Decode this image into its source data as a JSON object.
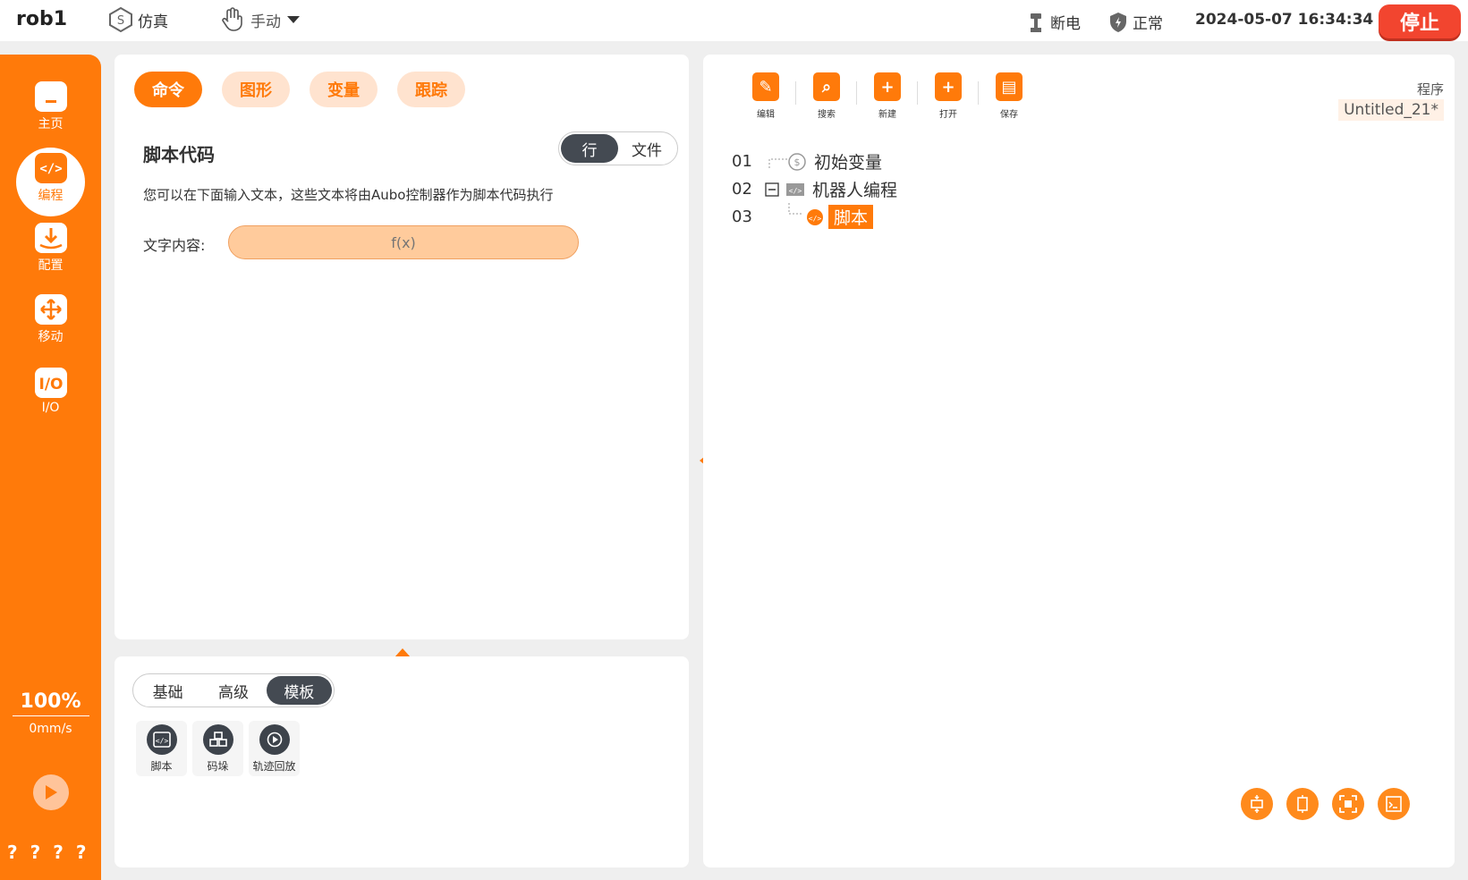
{
  "topbar": {
    "robot_name": "rob1",
    "mode_sim": "仿真",
    "mode_manual": "手动",
    "power_status": "断电",
    "safety_status": "正常",
    "datetime": "2024-05-07 16:34:34",
    "stop_label": "停止"
  },
  "sidebar": {
    "items": [
      {
        "label": "主页",
        "icon": "home-icon"
      },
      {
        "label": "编程",
        "icon": "code-icon"
      },
      {
        "label": "配置",
        "icon": "config-icon"
      },
      {
        "label": "移动",
        "icon": "move-icon"
      },
      {
        "label": "I/O",
        "icon": "io-icon"
      }
    ],
    "speed_percent": "100%",
    "speed_value": "0mm/s",
    "help": [
      "?",
      "?",
      "?",
      "?"
    ]
  },
  "command_panel": {
    "tabs": [
      "命令",
      "图形",
      "变量",
      "跟踪"
    ],
    "active_tab": "命令",
    "title": "脚本代码",
    "mode_options": [
      "行",
      "文件"
    ],
    "active_mode": "行",
    "description": "您可以在下面输入文本，这些文本将由Aubo控制器作为脚本代码执行",
    "field_label": "文字内容:",
    "field_placeholder": "f(x)"
  },
  "library_panel": {
    "categories": [
      "基础",
      "高级",
      "模板"
    ],
    "active_category": "模板",
    "items": [
      {
        "label": "脚本",
        "icon": "script-icon"
      },
      {
        "label": "码垛",
        "icon": "palletizing-icon"
      },
      {
        "label": "轨迹回放",
        "icon": "replay-icon"
      }
    ]
  },
  "program_panel": {
    "toolbar": [
      {
        "label": "编辑",
        "icon": "edit-icon"
      },
      {
        "label": "搜索",
        "icon": "search-icon"
      },
      {
        "label": "新建",
        "icon": "new-file-icon"
      },
      {
        "label": "打开",
        "icon": "open-folder-icon"
      },
      {
        "label": "保存",
        "icon": "save-icon"
      }
    ],
    "program_label": "程序",
    "program_name": "Untitled_21*",
    "tree": [
      {
        "line": "01",
        "label": "初始变量"
      },
      {
        "line": "02",
        "label": "机器人编程"
      },
      {
        "line": "03",
        "label": "脚本"
      }
    ],
    "bottom_tools": [
      "collapse-icon",
      "expand-icon",
      "fit-icon",
      "console-icon"
    ]
  },
  "colors": {
    "accent": "#ff7a0a",
    "stop": "#f2452f",
    "dark": "#444a52"
  }
}
